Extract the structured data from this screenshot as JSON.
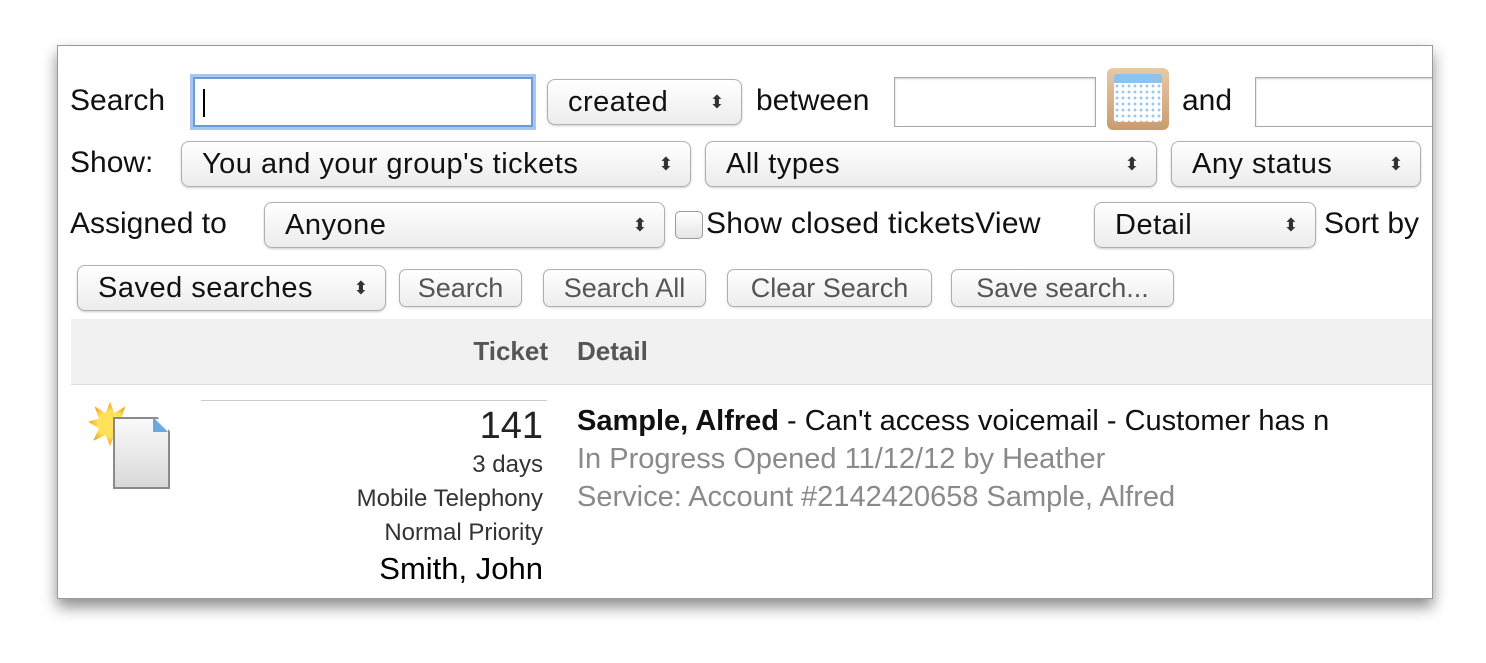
{
  "search": {
    "label": "Search",
    "value": "",
    "date_field": "created",
    "between_label": "between",
    "from_date": "",
    "and_label": "and",
    "to_date": ""
  },
  "show": {
    "label": "Show:",
    "scope": "You and your group's tickets",
    "type": "All types",
    "status": "Any status"
  },
  "assigned": {
    "label": "Assigned to",
    "value": "Anyone",
    "show_closed_label": "Show closed tickets",
    "show_closed_checked": false,
    "view_label": "View",
    "view_value": "Detail",
    "sort_label": "Sort by"
  },
  "actions": {
    "saved_searches": "Saved searches",
    "search": "Search",
    "search_all": "Search All",
    "clear_search": "Clear Search",
    "save_search": "Save search..."
  },
  "table": {
    "headers": [
      "Ticket",
      "Detail"
    ],
    "rows": [
      {
        "number": "141",
        "age": "3 days",
        "category": "Mobile Telephony",
        "priority": "Normal Priority",
        "assignee": "Smith, John",
        "customer": "Sample, Alfred",
        "summary": " - Can't access voicemail - Customer has n",
        "status_line": "In Progress Opened 11/12/12 by Heather",
        "service_line": "Service: Account #2142420658 Sample, Alfred",
        "icon": "new-ticket-icon"
      }
    ]
  }
}
